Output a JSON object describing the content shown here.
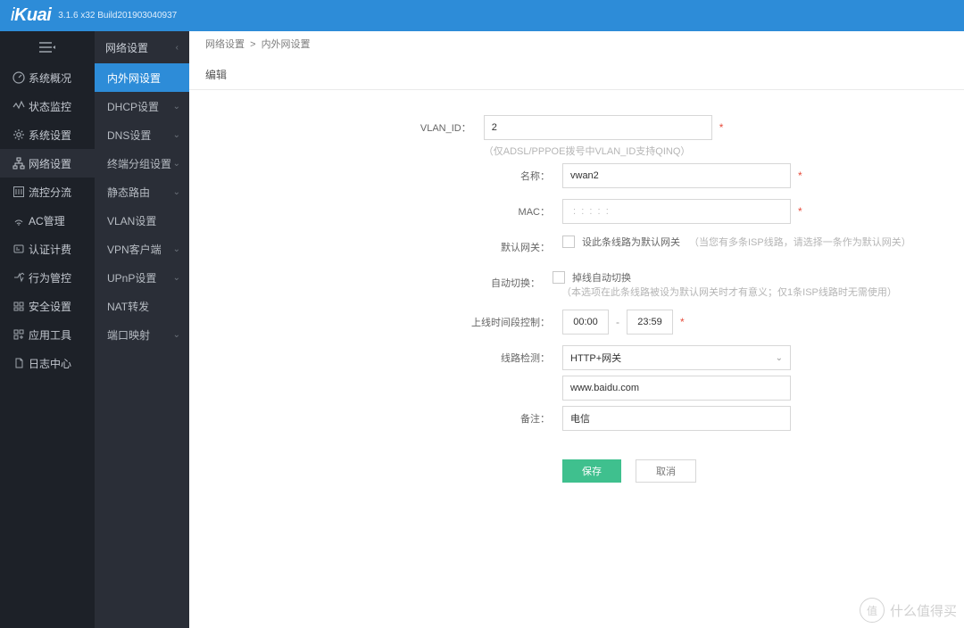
{
  "header": {
    "brand": "iKuai",
    "version": "3.1.6 x32 Build201903040937"
  },
  "sidebar_main": {
    "items": [
      {
        "icon": "dashboard-icon",
        "label": "系统概况"
      },
      {
        "icon": "monitor-icon",
        "label": "状态监控"
      },
      {
        "icon": "gear-icon",
        "label": "系统设置"
      },
      {
        "icon": "network-icon",
        "label": "网络设置",
        "active": true
      },
      {
        "icon": "flow-icon",
        "label": "流控分流"
      },
      {
        "icon": "ac-icon",
        "label": "AC管理"
      },
      {
        "icon": "auth-icon",
        "label": "认证计费"
      },
      {
        "icon": "behavior-icon",
        "label": "行为管控"
      },
      {
        "icon": "security-icon",
        "label": "安全设置"
      },
      {
        "icon": "tools-icon",
        "label": "应用工具"
      },
      {
        "icon": "log-icon",
        "label": "日志中心"
      }
    ]
  },
  "sidebar_sub": {
    "header": "网络设置",
    "items": [
      {
        "label": "内外网设置",
        "active": true,
        "expandable": false
      },
      {
        "label": "DHCP设置",
        "expandable": true
      },
      {
        "label": "DNS设置",
        "expandable": true
      },
      {
        "label": "终端分组设置",
        "expandable": true
      },
      {
        "label": "静态路由",
        "expandable": true
      },
      {
        "label": "VLAN设置"
      },
      {
        "label": "VPN客户端",
        "expandable": true
      },
      {
        "label": "UPnP设置",
        "expandable": true
      },
      {
        "label": "NAT转发"
      },
      {
        "label": "端口映射",
        "expandable": true
      }
    ]
  },
  "breadcrumb": {
    "parent": "网络设置",
    "current": "内外网设置"
  },
  "page": {
    "title": "编辑"
  },
  "form": {
    "vlan_id": {
      "label": "VLAN_ID：",
      "value": "2",
      "hint": "（仅ADSL/PPPOE拨号中VLAN_ID支持QINQ）"
    },
    "name": {
      "label": "名称：",
      "value": "vwan2"
    },
    "mac": {
      "label": "MAC：",
      "placeholder": " :  :  :  :  : "
    },
    "gateway": {
      "label": "默认网关：",
      "checkbox_label": "设此条线路为默认网关",
      "hint": "（当您有多条ISP线路，请选择一条作为默认网关）"
    },
    "auto_switch": {
      "label": "自动切换：",
      "checkbox_label": "掉线自动切换",
      "hint": "（本选项在此条线路被设为默认网关时才有意义；仅1条ISP线路时无需使用）"
    },
    "online_time": {
      "label": "上线时间段控制：",
      "start": "00:00",
      "end": "23:59"
    },
    "link_check": {
      "label": "线路检测：",
      "selected": "HTTP+网关",
      "url_value": "www.baidu.com"
    },
    "remark": {
      "label": "备注：",
      "value": "电信"
    },
    "buttons": {
      "save": "保存",
      "cancel": "取消"
    }
  },
  "watermark": {
    "badge": "值",
    "text": "什么值得买"
  }
}
